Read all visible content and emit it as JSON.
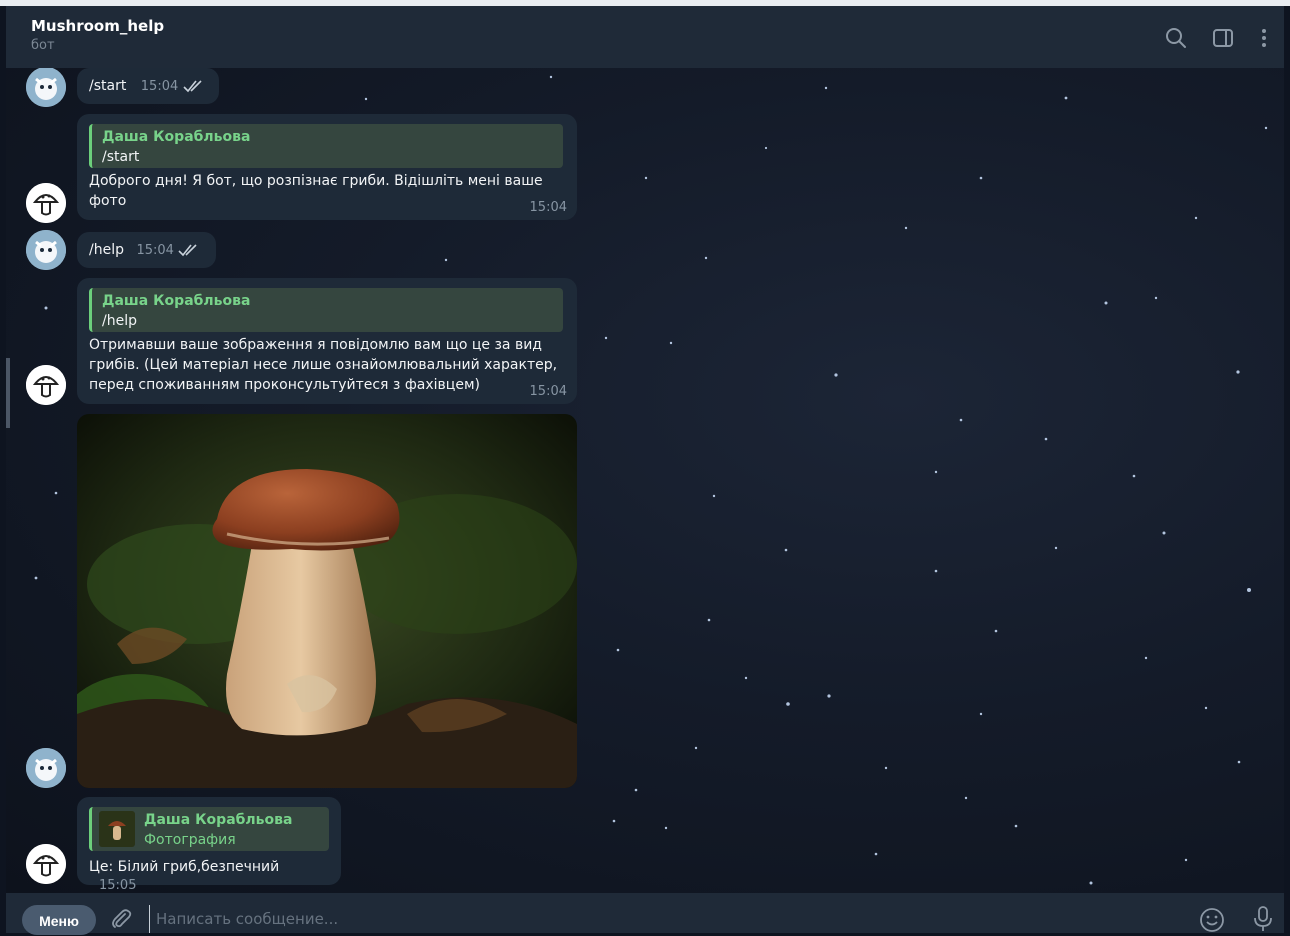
{
  "chat": {
    "title": "Mushroom_help",
    "subtitle": "бот"
  },
  "header_icons": [
    "search-icon",
    "sidebar-toggle-icon",
    "more-vertical-icon"
  ],
  "messages": [
    {
      "text": "/start",
      "time": "15:04"
    },
    {
      "reply_name": "Даша Корабльова",
      "reply_text": "/start",
      "text_lines": [
        "Доброго дня! Я бот, що розпізнає гриби. Відішліть мені ваше",
        "фото"
      ],
      "time": "15:04"
    },
    {
      "text": "/help",
      "time": "15:04"
    },
    {
      "reply_name": "Даша Корабльова",
      "reply_text": "/help",
      "text_lines": [
        "Отримавши ваше зображення я повідомлю вам що це за вид",
        "грибів. (Цей матеріал несе лише ознайомлювальний характер,",
        "перед споживанням проконсультуйтеся з фахівцем)"
      ],
      "time": "15:04"
    },
    {
      "reply_name": "Даша Корабльова",
      "reply_text": "Фотография",
      "text": "Це: Білий гриб,безпечний",
      "time": "15:05"
    }
  ],
  "composer": {
    "menu_label": "Меню",
    "placeholder": "Написать сообщение..."
  },
  "colors": {
    "header_bg": "#1f2a38",
    "bubble_bg": "#1e2a38",
    "reply_name": "#78d38a",
    "reply_bar": "#6ccf7b",
    "time": "#8795a3"
  }
}
